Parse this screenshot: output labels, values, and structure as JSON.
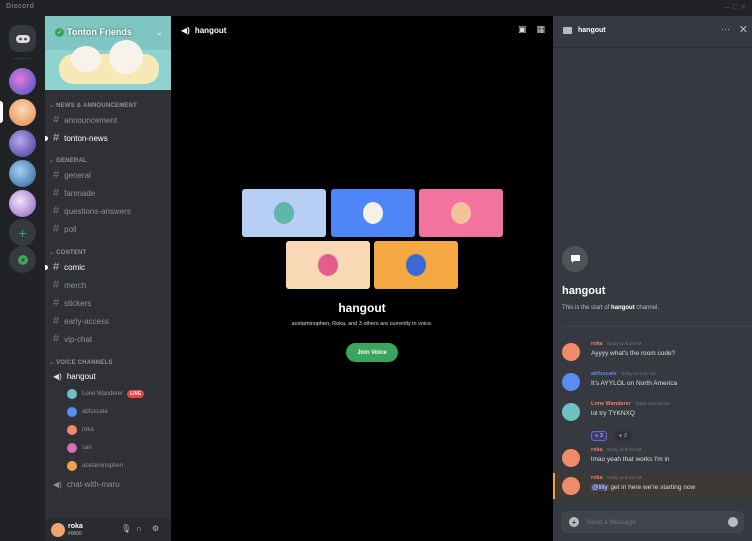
{
  "window": {
    "brand": "Discord",
    "controls": "—  ☐  ✕"
  },
  "server": {
    "name": "Tonton Friends"
  },
  "categories": {
    "news": "NEWS & ANNOUNCEMENT",
    "general": "GENERAL",
    "content": "CONTENT",
    "voice": "VOICE CHANNELS"
  },
  "channels": {
    "announcement": "announcement",
    "tonton_news": "tonton-news",
    "general": "general",
    "fanmade": "fanmade",
    "questions_answers": "questions-answers",
    "poll": "poll",
    "comic": "comic",
    "merch": "merch",
    "stickers": "stickers",
    "early_access": "early-access",
    "vip_chat": "vip-chat"
  },
  "voice_channels": {
    "hangout": "hangout",
    "chat_with_maru": "chat-with-maru"
  },
  "voice_users": [
    {
      "name": "Lone Wanderer",
      "live": "LIVE",
      "color": "#6fc2c4"
    },
    {
      "name": "abfuscate",
      "color": "#5b8cf0"
    },
    {
      "name": "roka",
      "color": "#f08b6a"
    },
    {
      "name": "san",
      "color": "#d96fb0"
    },
    {
      "name": "acetaminophen",
      "color": "#f2a24a"
    }
  ],
  "user_panel": {
    "name": "roka",
    "tag": "#0000"
  },
  "stage": {
    "channel": "hangout",
    "title": "hangout",
    "subtitle": "acetaminophen, Roka, and 3 others are currently in voice.",
    "join_label": "Join Voice"
  },
  "tiles": [
    {
      "bg": "#b8cff5",
      "avatar": "#5fb7a8"
    },
    {
      "bg": "#4f86f7",
      "avatar": "#f4f1e6"
    },
    {
      "bg": "#f272a0",
      "avatar": "#f2c29a"
    },
    {
      "bg": "#f9d9b5",
      "avatar": "#e25c8c"
    },
    {
      "bg": "#f5a742",
      "avatar": "#3c6ad6"
    }
  ],
  "chat": {
    "title": "hangout",
    "start_title": "hangout",
    "start_prefix": "This is the start of",
    "start_channel": "hangout",
    "start_suffix": "channel.",
    "placeholder": "Send a Message",
    "messages": [
      {
        "author": "roka",
        "time": "Today at 9:18 AM",
        "text": "Ayyyy what's the room code?",
        "color": "#f47b67",
        "avatar": "#f08b6a"
      },
      {
        "author": "abfuscate",
        "time": "Today at 9:18 AM",
        "text": "It's AYYLOL on North America",
        "color": "#5b8cf0",
        "avatar": "#5b8cf0"
      },
      {
        "author": "Lone Wanderer",
        "time": "Today at 9:18 AM",
        "text": "lol try TYKNXQ",
        "color": "#f47b67",
        "avatar": "#6fc2c4"
      },
      {
        "author": "roka",
        "time": "Today at 9:18 AM",
        "text": "lmao yeah that works I'm in",
        "color": "#f47b67",
        "avatar": "#f08b6a"
      },
      {
        "author": "roka",
        "time": "Today at 9:18 AM",
        "mention": "@lilly",
        "text": "get in here we're starting now",
        "color": "#f47b67",
        "avatar": "#f08b6a"
      }
    ],
    "reactions": [
      {
        "count": "3"
      },
      {
        "count": "3"
      }
    ]
  }
}
